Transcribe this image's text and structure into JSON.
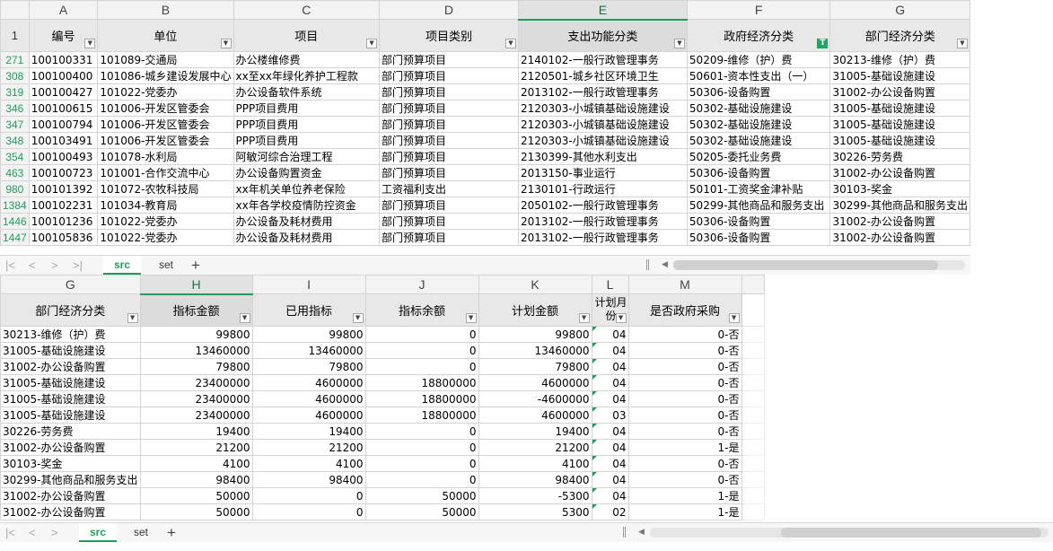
{
  "top_pane": {
    "col_letters": [
      "A",
      "B",
      "C",
      "D",
      "E",
      "F",
      "G"
    ],
    "header_row_number": "1",
    "headers": [
      "编号",
      "单位",
      "项目",
      "项目类别",
      "支出功能分类",
      "政府经济分类",
      "部门经济分类"
    ],
    "rows": [
      {
        "rn": "271",
        "cells": [
          "100100331",
          "101089-交通局",
          "办公楼维修费",
          "部门预算项目",
          "2140102-一般行政管理事务",
          "50209-维修（护）费",
          "30213-维修（护）费"
        ]
      },
      {
        "rn": "308",
        "cells": [
          "100100400",
          "101086-城乡建设发展中心",
          "xx至xx年绿化养护工程款",
          "部门预算项目",
          "2120501-城乡社区环境卫生",
          "50601-资本性支出（一）",
          "31005-基础设施建设"
        ]
      },
      {
        "rn": "319",
        "cells": [
          "100100427",
          "101022-党委办",
          "办公设备软件系统",
          "部门预算项目",
          "2013102-一般行政管理事务",
          "50306-设备购置",
          "31002-办公设备购置"
        ]
      },
      {
        "rn": "346",
        "cells": [
          "100100615",
          "101006-开发区管委会",
          "PPP项目费用",
          "部门预算项目",
          "2120303-小城镇基础设施建设",
          "50302-基础设施建设",
          "31005-基础设施建设"
        ]
      },
      {
        "rn": "347",
        "cells": [
          "100100794",
          "101006-开发区管委会",
          "PPP项目费用",
          "部门预算项目",
          "2120303-小城镇基础设施建设",
          "50302-基础设施建设",
          "31005-基础设施建设"
        ]
      },
      {
        "rn": "348",
        "cells": [
          "100103491",
          "101006-开发区管委会",
          "PPP项目费用",
          "部门预算项目",
          "2120303-小城镇基础设施建设",
          "50302-基础设施建设",
          "31005-基础设施建设"
        ]
      },
      {
        "rn": "354",
        "cells": [
          "100100493",
          "101078-水利局",
          "阿敏河综合治理工程",
          "部门预算项目",
          "2130399-其他水利支出",
          "50205-委托业务费",
          "30226-劳务费"
        ]
      },
      {
        "rn": "463",
        "cells": [
          "100100723",
          "101001-合作交流中心",
          "办公设备购置资金",
          "部门预算项目",
          "2013150-事业运行",
          "50306-设备购置",
          "31002-办公设备购置"
        ]
      },
      {
        "rn": "980",
        "cells": [
          "100101392",
          "101072-农牧科技局",
          "xx年机关单位养老保险",
          "工资福利支出",
          "2130101-行政运行",
          "50101-工资奖金津补贴",
          "30103-奖金"
        ]
      },
      {
        "rn": "1384",
        "cells": [
          "100102231",
          "101034-教育局",
          "xx年各学校疫情防控资金",
          "部门预算项目",
          "2050102-一般行政管理事务",
          "50299-其他商品和服务支出",
          "30299-其他商品和服务支出"
        ]
      },
      {
        "rn": "1446",
        "cells": [
          "100101236",
          "101022-党委办",
          "办公设备及耗材费用",
          "部门预算项目",
          "2013102-一般行政管理事务",
          "50306-设备购置",
          "31002-办公设备购置"
        ]
      },
      {
        "rn": "1447",
        "cells": [
          "100105836",
          "101022-党委办",
          "办公设备及耗材费用",
          "部门预算项目",
          "2013102-一般行政管理事务",
          "50306-设备购置",
          "31002-办公设备购置"
        ]
      }
    ]
  },
  "bottom_pane": {
    "col_letters": [
      "G",
      "H",
      "I",
      "J",
      "K",
      "L",
      "M"
    ],
    "headers": [
      "部门经济分类",
      "指标金额",
      "已用指标",
      "指标余额",
      "计划金额",
      "计划月份",
      "是否政府采购"
    ],
    "rows": [
      [
        "30213-维修（护）费",
        "99800",
        "99800",
        "0",
        "99800",
        "04",
        "0-否"
      ],
      [
        "31005-基础设施建设",
        "13460000",
        "13460000",
        "0",
        "13460000",
        "04",
        "0-否"
      ],
      [
        "31002-办公设备购置",
        "79800",
        "79800",
        "0",
        "79800",
        "04",
        "0-否"
      ],
      [
        "31005-基础设施建设",
        "23400000",
        "4600000",
        "18800000",
        "4600000",
        "04",
        "0-否"
      ],
      [
        "31005-基础设施建设",
        "23400000",
        "4600000",
        "18800000",
        "-4600000",
        "04",
        "0-否"
      ],
      [
        "31005-基础设施建设",
        "23400000",
        "4600000",
        "18800000",
        "4600000",
        "03",
        "0-否"
      ],
      [
        "30226-劳务费",
        "19400",
        "19400",
        "0",
        "19400",
        "04",
        "0-否"
      ],
      [
        "31002-办公设备购置",
        "21200",
        "21200",
        "0",
        "21200",
        "04",
        "1-是"
      ],
      [
        "30103-奖金",
        "4100",
        "4100",
        "0",
        "4100",
        "04",
        "0-否"
      ],
      [
        "30299-其他商品和服务支出",
        "98400",
        "98400",
        "0",
        "98400",
        "04",
        "0-否"
      ],
      [
        "31002-办公设备购置",
        "50000",
        "0",
        "50000",
        "-5300",
        "04",
        "1-是"
      ],
      [
        "31002-办公设备购置",
        "50000",
        "0",
        "50000",
        "5300",
        "02",
        "1-是"
      ]
    ]
  },
  "sheet_tabs": [
    "src",
    "set"
  ],
  "active_tab": "src",
  "icons": {
    "nav": [
      "first-sheet-icon",
      "prev-sheet-icon",
      "next-sheet-icon",
      "last-sheet-icon"
    ],
    "add": "add-sheet-icon",
    "filter": "filter-dropdown-icon",
    "filter_active": "filter-active-icon"
  },
  "colors": {
    "accent": "#1e9e5a",
    "header_bg": "#e8e8e8",
    "grid": "#d4d4d4"
  }
}
